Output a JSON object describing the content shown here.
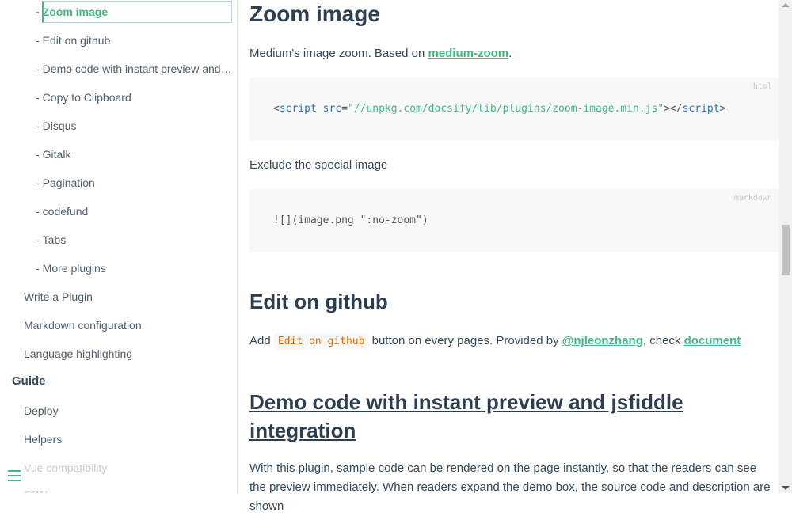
{
  "sidebar": {
    "plugin_items": [
      "Zoom image",
      "Edit on github",
      "Demo code with instant preview and js…",
      "Copy to Clipboard",
      "Disqus",
      "Gitalk",
      "Pagination",
      "codefund",
      "Tabs",
      "More plugins"
    ],
    "dash": "-",
    "sub_items": [
      "Write a Plugin",
      "Markdown configuration",
      "Language highlighting"
    ],
    "section_guide": "Guide",
    "guide_items": [
      "Deploy",
      "Helpers",
      "Vue compatibility",
      "CDN"
    ]
  },
  "content": {
    "zoom_title": "Zoom image",
    "zoom_desc_prefix": "Medium's image zoom. Based on ",
    "zoom_desc_link": "medium-zoom",
    "zoom_desc_suffix": ".",
    "code1": {
      "lang": "html",
      "lt": "<",
      "tag": "script",
      "attr": " src",
      "eq": "=",
      "value": "\"//unpkg.com/docsify/lib/plugins/zoom-image.min.js\"",
      "close": "></",
      "tag_end": "script",
      "gt": ">"
    },
    "exclude_text": "Exclude the special image",
    "code2": {
      "lang": "markdown",
      "line": "![](image.png \":no-zoom\")"
    },
    "edit_title": "Edit on github",
    "edit_add": "Add ",
    "edit_code": "Edit on github",
    "edit_mid": " button on every pages. Provided by ",
    "edit_link1": "@njleonzhang",
    "edit_check": ", check ",
    "edit_link2": "document",
    "demo_title": "Demo code with instant preview and jsfiddle integration",
    "demo_text": "With this plugin, sample code can be rendered on the page instantly, so that the readers can see the preview immediately. When readers expand the demo box, the source code and description are shown"
  },
  "colors": {
    "accent": "#42b983",
    "text": "#34495e"
  }
}
